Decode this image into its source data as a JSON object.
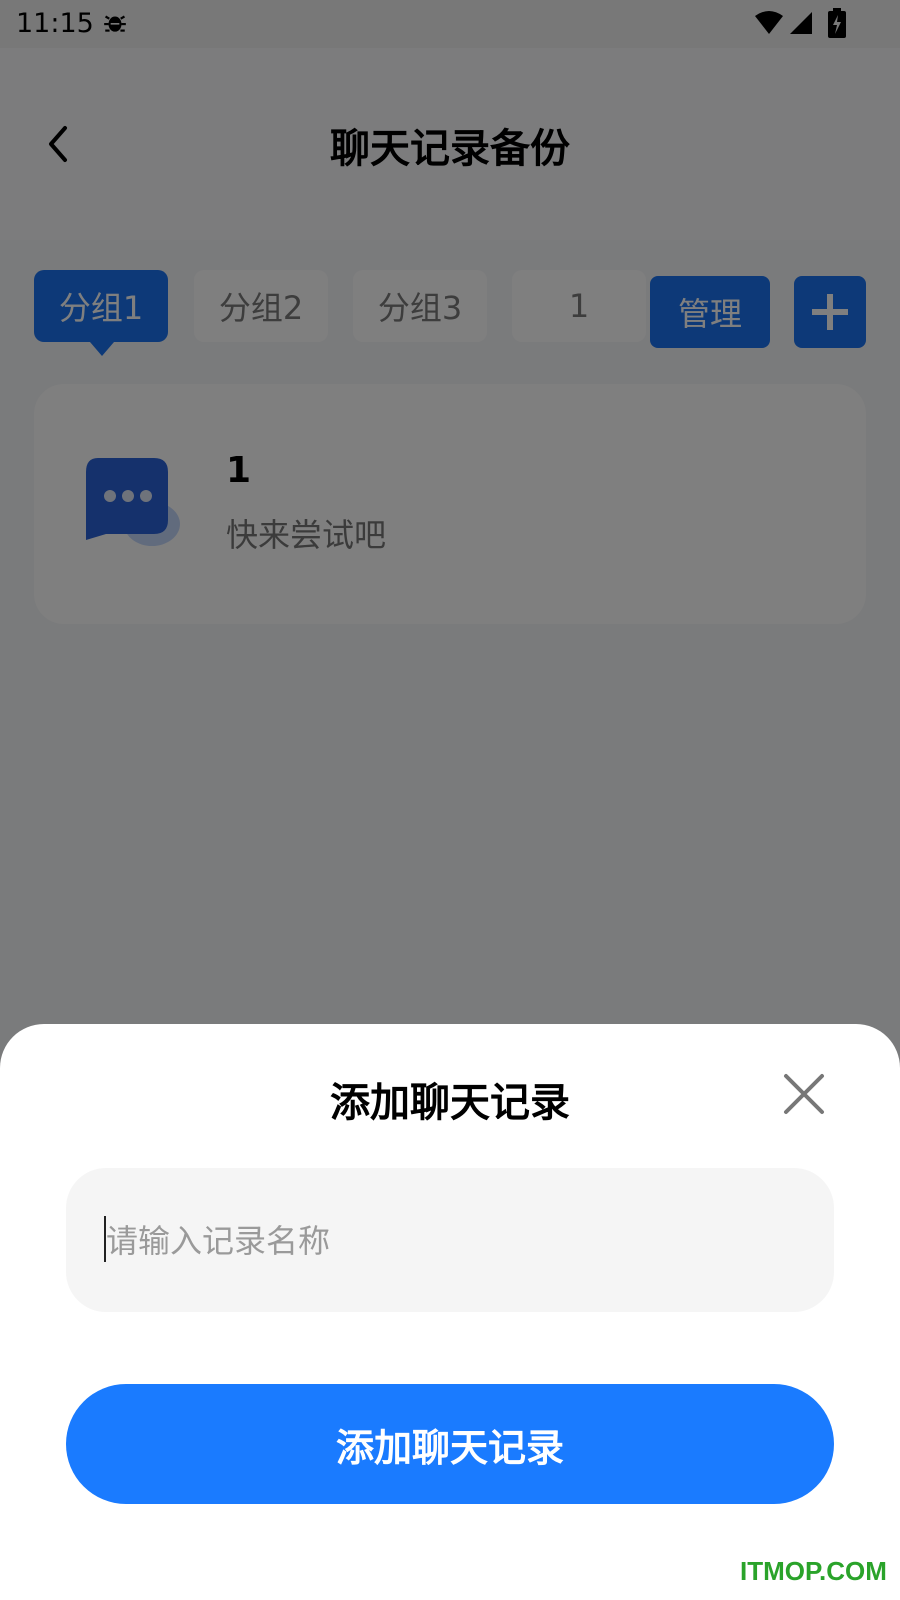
{
  "status_bar": {
    "time": "11:15"
  },
  "header": {
    "title": "聊天记录备份"
  },
  "tabs": [
    {
      "label": "分组1",
      "active": true
    },
    {
      "label": "分组2",
      "active": false
    },
    {
      "label": "分组3",
      "active": false
    },
    {
      "label": "1",
      "active": false
    }
  ],
  "toolbar": {
    "manage_label": "管理"
  },
  "record": {
    "title": "1",
    "subtitle": "快来尝试吧"
  },
  "sheet": {
    "title": "添加聊天记录",
    "input_placeholder": "请输入记录名称",
    "input_value": "",
    "submit_label": "添加聊天记录"
  },
  "watermark": "ITMOP.COM",
  "colors": {
    "accent": "#1a73f0",
    "submit": "#1a7bff",
    "watermark": "#2aa32a"
  }
}
